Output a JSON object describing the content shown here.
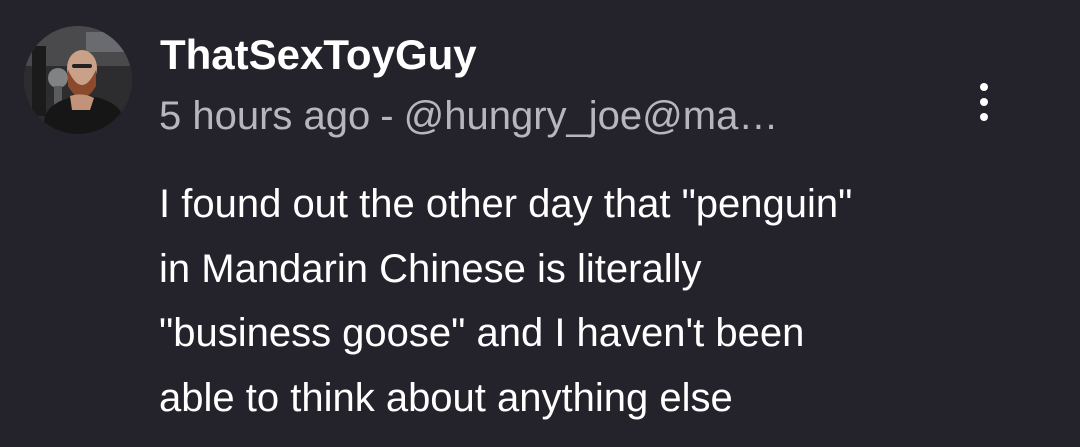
{
  "post": {
    "author": {
      "display_name": "ThatSexToyGuy",
      "avatar_icon": "person-with-beard-icon"
    },
    "timestamp": "5 hours ago",
    "separator": "-",
    "handle": "@hungry_joe@ma…",
    "menu_icon": "more-vertical-icon",
    "body_lines": [
      "I found out the other day that \"penguin\"",
      "in Mandarin Chinese is literally",
      "\"business goose\" and I haven't been",
      "able to think about anything else"
    ]
  },
  "colors": {
    "background": "#24222b",
    "primary_text": "#ffffff",
    "secondary_text": "#b7b6be"
  }
}
